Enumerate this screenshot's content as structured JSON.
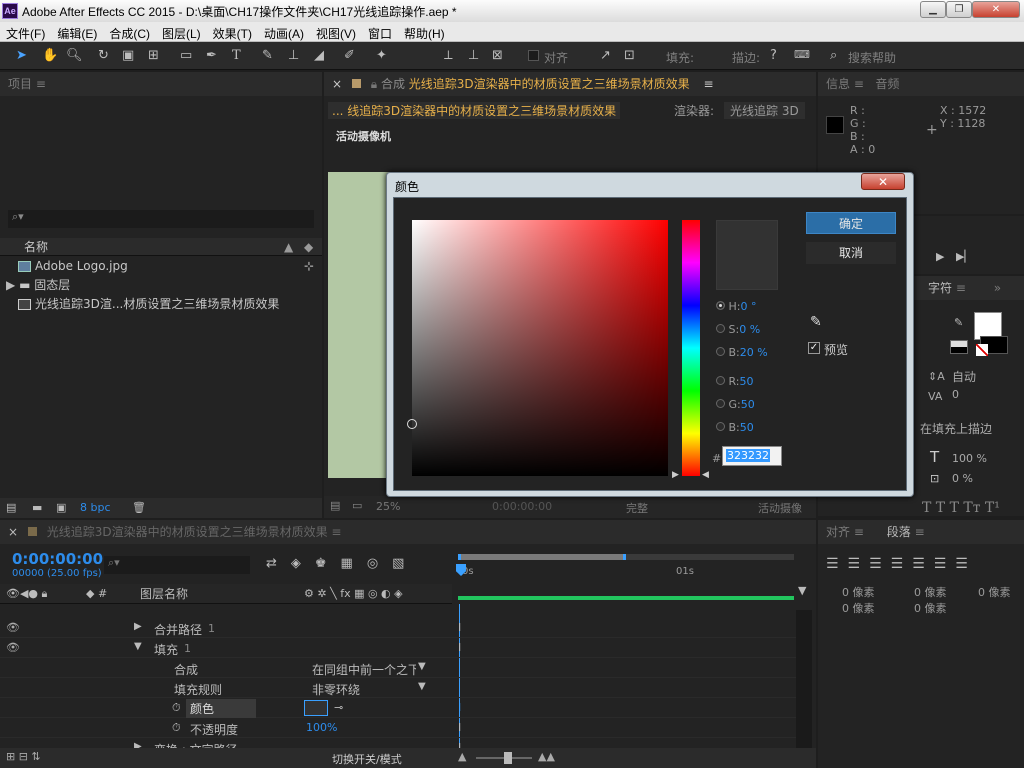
{
  "window": {
    "title": "Adobe After Effects CC 2015 - D:\\桌面\\CH17操作文件夹\\CH17光线追踪操作.aep *",
    "app_icon_text": "Ae",
    "minimize": "▁",
    "restore": "❐",
    "close": "✕"
  },
  "menu": [
    "文件(F)",
    "编辑(E)",
    "合成(C)",
    "图层(L)",
    "效果(T)",
    "动画(A)",
    "视图(V)",
    "窗口",
    "帮助(H)"
  ],
  "toolbar": {
    "align_label": "对齐",
    "fill_label": "填充:",
    "stroke_label": "描边:",
    "search_placeholder": "搜索帮助"
  },
  "project": {
    "title": "项目",
    "column_name": "名称",
    "items": [
      {
        "name": "Adobe Logo.jpg",
        "icon": "image-icon"
      },
      {
        "name": "固态层",
        "icon": "folder-icon"
      },
      {
        "name": "光线追踪3D渲...材质设置之三维场景材质效果",
        "icon": "composition-icon"
      }
    ],
    "bpc": "8 bpc"
  },
  "composition": {
    "tab_label": "合成",
    "tab_name": "光线追踪3D渲染器中的材质设置之三维场景材质效果",
    "breadcrumb": "... 线追踪3D渲染器中的材质设置之三维场景材质效果",
    "renderer_label": "渲染器:",
    "renderer_value": "光线追踪 3D",
    "active_camera": "活动摄像机",
    "zoom": "25%",
    "time": "0:00:00:00",
    "quality": "完整",
    "camera_bottom": "活动摄像"
  },
  "info_panel": {
    "title": "信息",
    "audio_tab": "音频",
    "r": "R :",
    "g": "G :",
    "b": "B :",
    "a": "A : 0",
    "x": "X : 1572",
    "y": "Y : 1128"
  },
  "char_panel": {
    "title": "字符",
    "auto": "自动",
    "va": "0",
    "stroke_mode": "在填充上描边",
    "size_pct": "100 %",
    "baseline_pct": "0 %"
  },
  "align_panel": {
    "title": "对齐",
    "para_tab": "段落",
    "indent_rows": [
      [
        "0 像素",
        "0 像素",
        "0 像素"
      ],
      [
        "0 像素",
        "0 像素",
        ""
      ]
    ]
  },
  "timeline": {
    "tab_name": "光线追踪3D渲染器中的材质设置之三维场景材质效果",
    "timecode": "0:00:00:00",
    "fps": "00000 (25.00 fps)",
    "layer_col": "图层名称",
    "ruler_0": "0s",
    "ruler_1": "01s",
    "rows": [
      {
        "indent": 1,
        "twirl": "▶",
        "label": "合并路径",
        "extra": "1",
        "value": ""
      },
      {
        "indent": 1,
        "twirl": "▼",
        "label": "填充",
        "extra": "1",
        "value": ""
      },
      {
        "indent": 2,
        "twirl": "",
        "label": "合成",
        "extra": "",
        "value": "在同组中前一个之下"
      },
      {
        "indent": 2,
        "twirl": "",
        "label": "填充规则",
        "extra": "",
        "value": "非零环绕"
      },
      {
        "indent": 2,
        "twirl": "",
        "label": "颜色",
        "extra": "",
        "value": ""
      },
      {
        "indent": 2,
        "twirl": "",
        "label": "不透明度",
        "extra": "",
        "value": "100%"
      },
      {
        "indent": 1,
        "twirl": "▶",
        "label": "变换 : 文字路径",
        "extra": "",
        "value": ""
      }
    ],
    "switch_mode": "切换开关/模式"
  },
  "color_dialog": {
    "title": "颜色",
    "ok": "确定",
    "cancel": "取消",
    "preview": "预览",
    "h_label": "H:",
    "h_value": "0 °",
    "s_label": "S:",
    "s_value": "0 %",
    "b_label": "B:",
    "b_value": "20 %",
    "r_label": "R:",
    "r_value": "50",
    "g_label": "G:",
    "g_value": "50",
    "bb_label": "B:",
    "bb_value": "50",
    "hash": "#",
    "hex": "323232",
    "current_color": "#323232",
    "hue_color": "#ff0000"
  }
}
